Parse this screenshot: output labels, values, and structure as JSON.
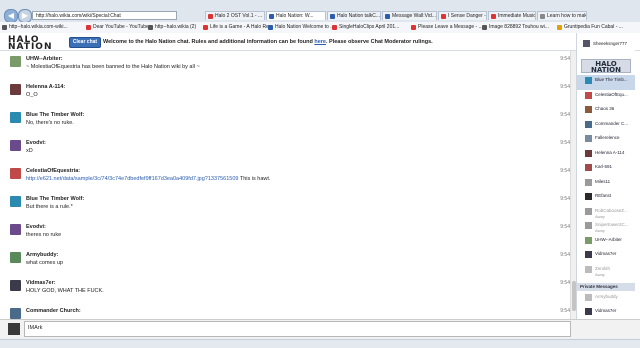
{
  "browser": {
    "url": "http://halo.wikia.com/wiki/Special:Chat",
    "tabs": [
      {
        "label": "Halo 2 OST Vol.1 - ...",
        "color": "#d33"
      },
      {
        "label": "Halo Nation: W...",
        "color": "#2a5db0"
      },
      {
        "label": "Halo Nation talkC...",
        "color": "#2a5db0"
      },
      {
        "label": "Message Wall:Vid...",
        "color": "#2a5db0"
      },
      {
        "label": "I Sense Danger - A...",
        "color": "#d33"
      },
      {
        "label": "Immediate Music -...",
        "color": "#d33"
      },
      {
        "label": "Learn how to mak...",
        "color": "#888"
      }
    ],
    "bookmarks": [
      {
        "label": "http--halo.wikia.com-wiki...",
        "color": "#555"
      },
      {
        "label": "Dear YouTube - YouTube",
        "color": "#d33"
      },
      {
        "label": "http--halo.wikia (2)",
        "color": "#555"
      },
      {
        "label": "Life is a Game - A Halo Re...",
        "color": "#d33"
      },
      {
        "label": "Halo Nation Welcome to ...",
        "color": "#2a5db0"
      },
      {
        "label": "SingleHaloClips April 201...",
        "color": "#d33"
      },
      {
        "label": "Please Leave a Message - ...",
        "color": "#d33"
      },
      {
        "label": "Image 828892 Touhou wi...",
        "color": "#555"
      },
      {
        "label": "Gruntipedia Fun Cabal - ...",
        "color": "#e0a000"
      }
    ]
  },
  "header": {
    "logo": "HALO NATION",
    "clear_chat": "Clear chat",
    "welcome_pre": "Welcome to the Halo Nation chat. Rules and additional information can be found ",
    "welcome_link": "here",
    "welcome_post": ". Please observe Chat Moderator rulings."
  },
  "messages": [
    {
      "user": "UHW--Arbiter:",
      "text": "~ MolestiaOfEquestria has been banned to the Halo Nation wiki by all ~",
      "time": "9:54",
      "color": "#7a9a6a",
      "link": ""
    },
    {
      "user": "Helenna A-114:",
      "text": "O_O",
      "time": "9:54",
      "color": "#6b3a3a",
      "link": ""
    },
    {
      "user": "Blue The Timber Wolf:",
      "text": "No, there's no ruke.",
      "time": "9:54",
      "color": "#2a8ab0",
      "link": ""
    },
    {
      "user": "Evodvi:",
      "text": "xD",
      "time": "9:54",
      "color": "#6a4a8a",
      "link": ""
    },
    {
      "user": "CelestiaOfEquestria:",
      "text": "",
      "time": "9:54",
      "color": "#c04a4a",
      "link": "http://e621.net/data/sample/3c/74/3c74e7dbedfef9ff167d3ea0a409fd7.jpg?1337561509",
      "link_suffix": " This is hawt."
    },
    {
      "user": "Blue The Timber Wolf:",
      "text": "But there is a rule.*",
      "time": "9:54",
      "color": "#2a8ab0",
      "link": ""
    },
    {
      "user": "Evodvi:",
      "text": "theres no ruke",
      "time": "9:54",
      "color": "#6a4a8a",
      "link": ""
    },
    {
      "user": "Armybuddy:",
      "text": "what comes up",
      "time": "9:54",
      "color": "#5a8a5a",
      "link": ""
    },
    {
      "user": "Vidmas7er:",
      "text": "HOLY GOD, WHAT THE FUCK.",
      "time": "9:54",
      "color": "#3a3a4a",
      "link": ""
    },
    {
      "user": "Commander Church:",
      "text": "",
      "time": "9:54",
      "color": "#4a6a8a",
      "link": ""
    }
  ],
  "sidebar": {
    "self": "Sheeeksnger777",
    "logo": "HALO NATION",
    "users": [
      {
        "name": "Blue The Timb...",
        "status": "",
        "color": "#2a8ab0",
        "away": false
      },
      {
        "name": "CelestiaOfEqu...",
        "status": "",
        "color": "#c04a4a",
        "away": false
      },
      {
        "name": "Chaos 36",
        "status": "",
        "color": "#8a5a3a",
        "away": false
      },
      {
        "name": "Commander C...",
        "status": "",
        "color": "#4a6a8a",
        "away": false
      },
      {
        "name": "Fallerelence",
        "status": "",
        "color": "#7a8aa0",
        "away": false
      },
      {
        "name": "Helenna A-114",
        "status": "",
        "color": "#6b3a3a",
        "away": false
      },
      {
        "name": "Karl-591",
        "status": "",
        "color": "#a04a4a",
        "away": false
      },
      {
        "name": "Miles11",
        "status": "",
        "color": "#9a9a9a",
        "away": false
      },
      {
        "name": "REfanst",
        "status": "",
        "color": "#2a2a2a",
        "away": false
      },
      {
        "name": "RobCabooseZ...",
        "status": "Away",
        "color": "#9a9a9a",
        "away": true
      },
      {
        "name": "Snipertower2C...",
        "status": "Away",
        "color": "#9a9a9a",
        "away": true
      },
      {
        "name": "UHW--Arbiter",
        "status": "",
        "color": "#7a9a6a",
        "away": false
      },
      {
        "name": "Vidmas7er",
        "status": "",
        "color": "#3a3a4a",
        "away": false
      },
      {
        "name": "Zerolith",
        "status": "Away",
        "color": "#bbbbbb",
        "away": true
      }
    ],
    "private_header": "Private Messages",
    "private": [
      {
        "name": "Armybuddy",
        "color": "#bbbbbb",
        "away": true
      },
      {
        "name": "Vidmas7er",
        "color": "#3a3a4a",
        "away": false
      }
    ]
  },
  "input": {
    "value": "IMArk"
  }
}
